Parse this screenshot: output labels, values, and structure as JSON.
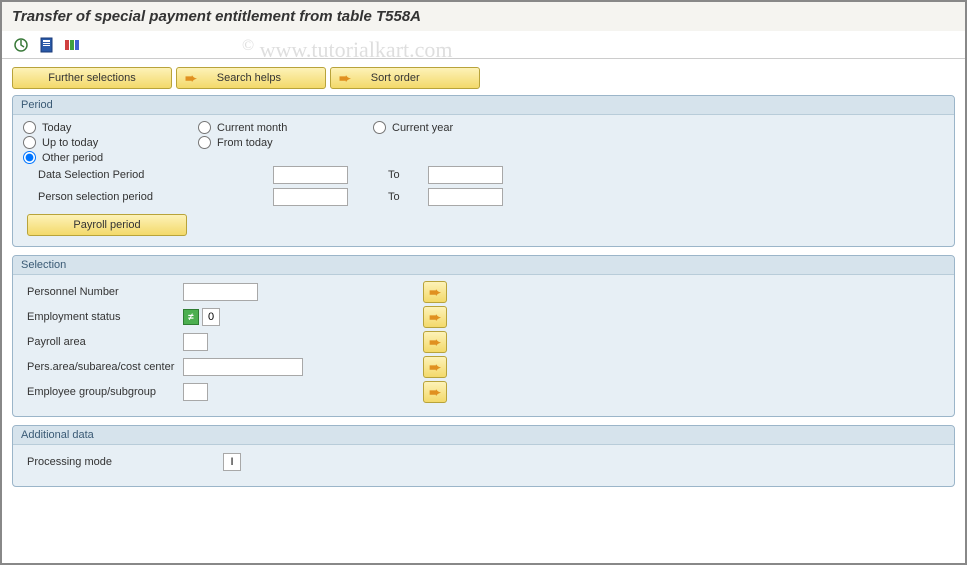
{
  "title": "Transfer of special payment entitlement from table T558A",
  "watermark": "www.tutorialkart.com",
  "buttons": {
    "further_selections": "Further selections",
    "search_helps": "Search helps",
    "sort_order": "Sort order",
    "payroll_period": "Payroll period"
  },
  "period": {
    "header": "Period",
    "today": "Today",
    "current_month": "Current month",
    "current_year": "Current year",
    "up_to_today": "Up to today",
    "from_today": "From today",
    "other_period": "Other period",
    "data_selection": "Data Selection Period",
    "person_selection": "Person selection period",
    "to": "To",
    "data_from": "",
    "data_to": "",
    "person_from": "",
    "person_to": ""
  },
  "selection": {
    "header": "Selection",
    "personnel_number": "Personnel Number",
    "employment_status": "Employment status",
    "employment_status_val": "0",
    "payroll_area": "Payroll area",
    "pers_area": "Pers.area/subarea/cost center",
    "employee_group": "Employee group/subgroup"
  },
  "additional": {
    "header": "Additional data",
    "processing_mode": "Processing mode",
    "processing_mode_val": "I"
  }
}
